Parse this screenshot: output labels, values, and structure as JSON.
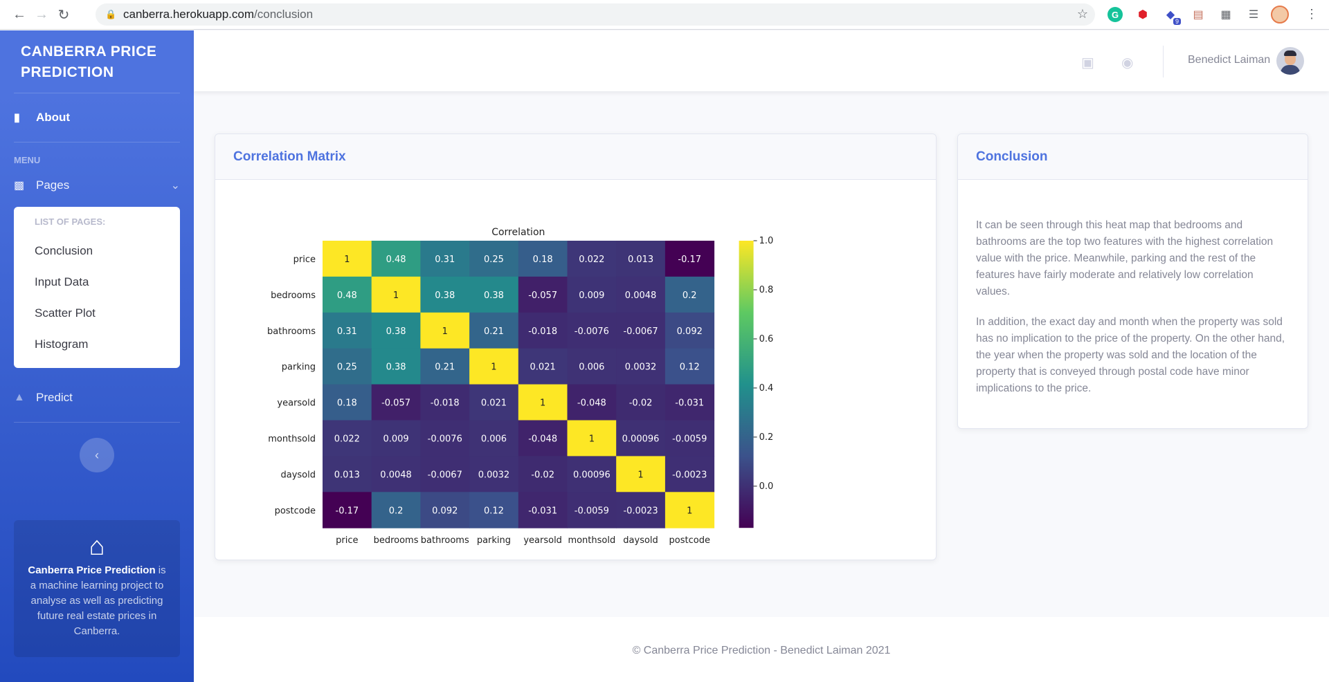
{
  "browser": {
    "url_host": "canberra.herokuapp.com",
    "url_path": "/conclusion",
    "ext_badge": "9"
  },
  "sidebar": {
    "brand": "Canberra Price Prediction",
    "about": "About",
    "menu_heading": "Menu",
    "pages": "Pages",
    "collapse_heading": "List of Pages:",
    "items": [
      "Conclusion",
      "Input Data",
      "Scatter Plot",
      "Histogram"
    ],
    "predict": "Predict",
    "promo_brand": "Canberra Price Prediction",
    "promo_text": " is a machine learning project to analyse as well as predicting future real estate prices in Canberra."
  },
  "topbar": {
    "user_name": "Benedict Laiman"
  },
  "matrix_card": {
    "title": "Correlation Matrix"
  },
  "conclusion_card": {
    "title": "Conclusion",
    "paragraph1": "It can be seen through this heat map that bedrooms and bathrooms are the top two features with the highest correlation value with the price. Meanwhile, parking and the rest of the features have fairly moderate and relatively low correlation values.",
    "paragraph2": "In addition, the exact day and month when the property was sold has no implication to the price of the property. On the other hand, the year when the property was sold and the location of the property that is conveyed through postal code have minor implications to the price."
  },
  "footer": {
    "text": "© Canberra Price Prediction - Benedict Laiman 2021"
  },
  "chart_data": {
    "type": "heatmap",
    "title": "Correlation",
    "labels": [
      "price",
      "bedrooms",
      "bathrooms",
      "parking",
      "yearsold",
      "monthsold",
      "daysold",
      "postcode"
    ],
    "values": [
      [
        "1",
        "0.48",
        "0.31",
        "0.25",
        "0.18",
        "0.022",
        "0.013",
        "-0.17"
      ],
      [
        "0.48",
        "1",
        "0.38",
        "0.38",
        "-0.057",
        "0.009",
        "0.0048",
        "0.2"
      ],
      [
        "0.31",
        "0.38",
        "1",
        "0.21",
        "-0.018",
        "-0.0076",
        "-0.0067",
        "0.092"
      ],
      [
        "0.25",
        "0.38",
        "0.21",
        "1",
        "0.021",
        "0.006",
        "0.0032",
        "0.12"
      ],
      [
        "0.18",
        "-0.057",
        "-0.018",
        "0.021",
        "1",
        "-0.048",
        "-0.02",
        "-0.031"
      ],
      [
        "0.022",
        "0.009",
        "-0.0076",
        "0.006",
        "-0.048",
        "1",
        "0.00096",
        "-0.0059"
      ],
      [
        "0.013",
        "0.0048",
        "-0.0067",
        "0.0032",
        "-0.02",
        "0.00096",
        "1",
        "-0.0023"
      ],
      [
        "-0.17",
        "0.2",
        "0.092",
        "0.12",
        "-0.031",
        "-0.0059",
        "-0.0023",
        "1"
      ]
    ],
    "colorbar_ticks": [
      "1.0",
      "0.8",
      "0.6",
      "0.4",
      "0.2",
      "0.0"
    ],
    "vmin": -0.17,
    "vmax": 1.0,
    "colormap": "viridis"
  }
}
